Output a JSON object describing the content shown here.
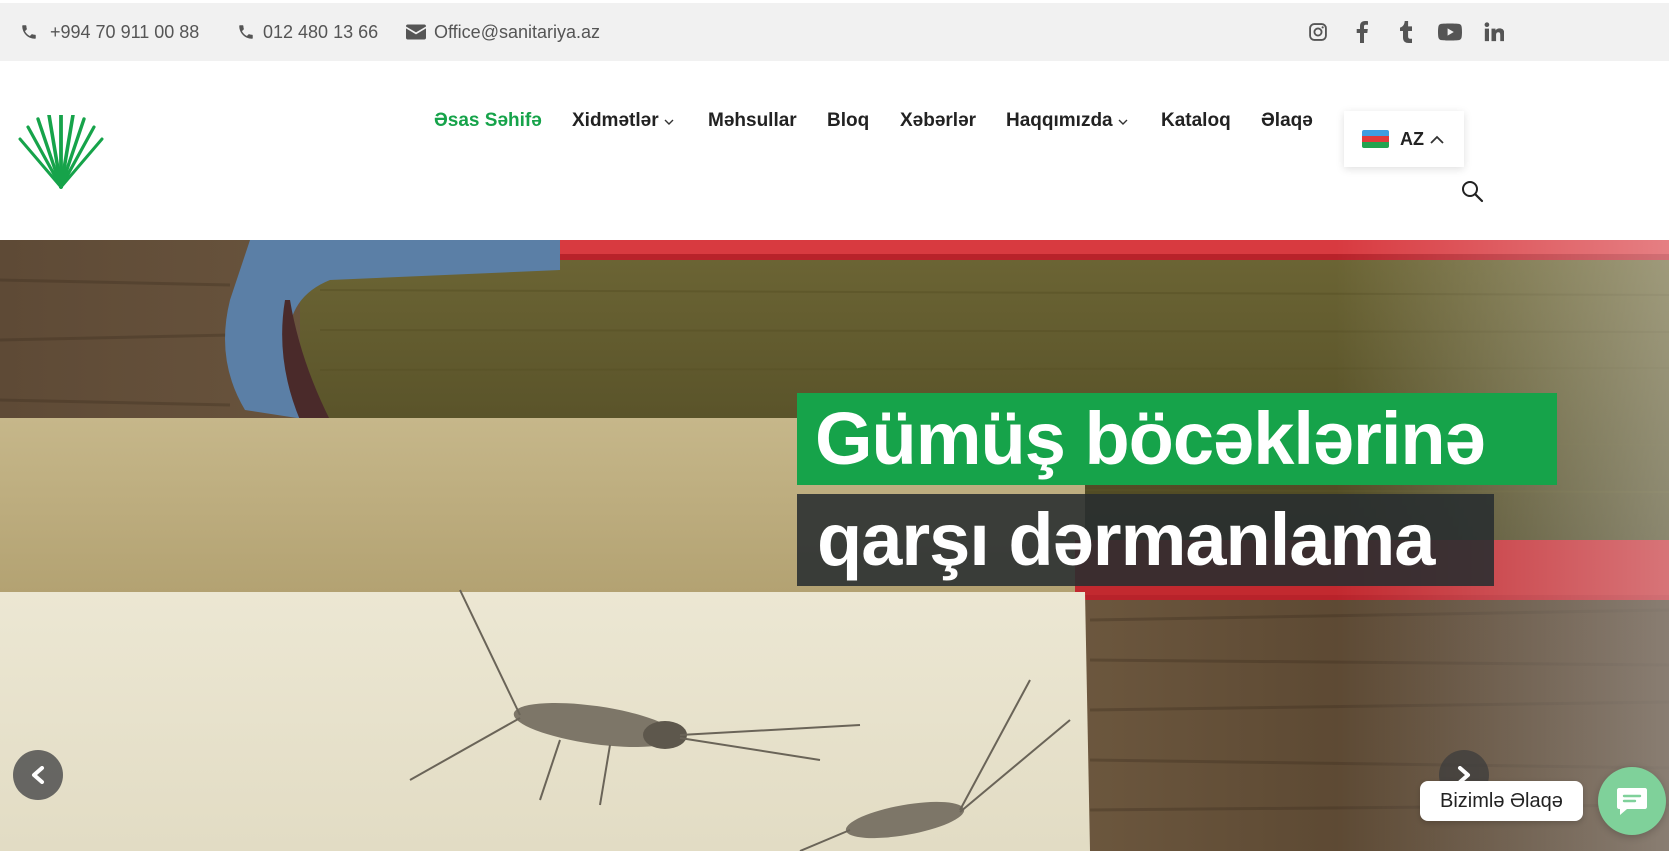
{
  "topbar": {
    "phone1": "+994 70 911 00 88",
    "phone2": "012 480 13 66",
    "email": "Office@sanitariya.az",
    "icons": [
      "phone-icon",
      "phone-icon",
      "envelope-icon"
    ],
    "socials": [
      "instagram-icon",
      "facebook-icon",
      "tumblr-icon",
      "youtube-icon",
      "linkedin-icon"
    ]
  },
  "nav": {
    "items": [
      {
        "label": "Əsas Səhifə",
        "active": true,
        "dropdown": false
      },
      {
        "label": "Xidmətlər",
        "active": false,
        "dropdown": true
      },
      {
        "label": "Məhsullar",
        "active": false,
        "dropdown": false
      },
      {
        "label": "Bloq",
        "active": false,
        "dropdown": false
      },
      {
        "label": "Xəbərlər",
        "active": false,
        "dropdown": false
      },
      {
        "label": "Haqqımızda",
        "active": false,
        "dropdown": true
      },
      {
        "label": "Kataloq",
        "active": false,
        "dropdown": false
      },
      {
        "label": "Əlaqə",
        "active": false,
        "dropdown": false
      }
    ],
    "language": "AZ",
    "search_icon": "search-icon"
  },
  "hero": {
    "line1": "Gümüş böcəklərinə",
    "line2": "qarşı dərmanlama",
    "chat_label": "Bizimlə Əlaqə"
  },
  "colors": {
    "brand_green": "#16a34a",
    "topbar_bg": "#f1f1f1",
    "text_dark": "#222222",
    "chat_green": "#7fd19a"
  }
}
